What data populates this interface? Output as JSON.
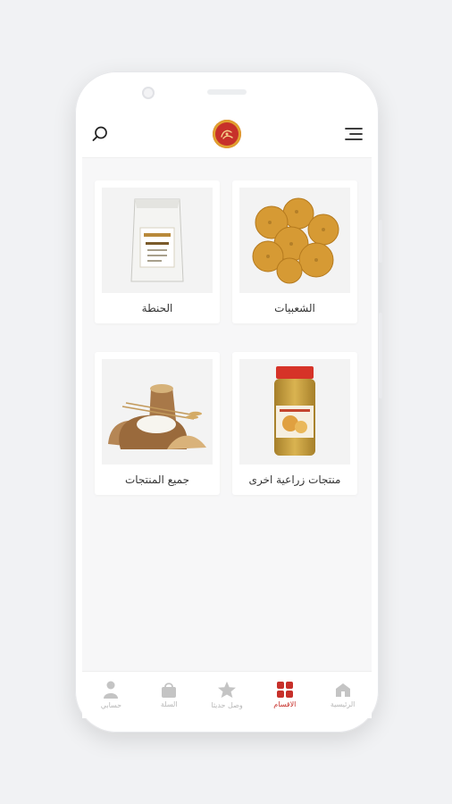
{
  "header": {
    "menu_icon": "hamburger-menu-icon",
    "search_icon": "search-icon",
    "logo_icon": "brand-logo-icon"
  },
  "categories": [
    {
      "label": "الشعبيات",
      "image": "biscuits-photo"
    },
    {
      "label": "الحنطة",
      "image": "flour-bag-photo"
    },
    {
      "label": "منتجات زراعية اخرى",
      "image": "spice-jar-photo"
    },
    {
      "label": "جميع المنتجات",
      "image": "wheat-sack-photo"
    }
  ],
  "bottom_nav": [
    {
      "label": "الرئيسية",
      "icon": "home-icon",
      "active": false
    },
    {
      "label": "الاقسام",
      "icon": "grid-icon",
      "active": true
    },
    {
      "label": "وصل حديثا",
      "icon": "star-icon",
      "active": false
    },
    {
      "label": "السلة",
      "icon": "cart-icon",
      "active": false
    },
    {
      "label": "حسابي",
      "icon": "user-icon",
      "active": false
    }
  ],
  "colors": {
    "accent": "#c7302a",
    "inactive": "#c4c4c4",
    "background": "#f7f7f8"
  }
}
